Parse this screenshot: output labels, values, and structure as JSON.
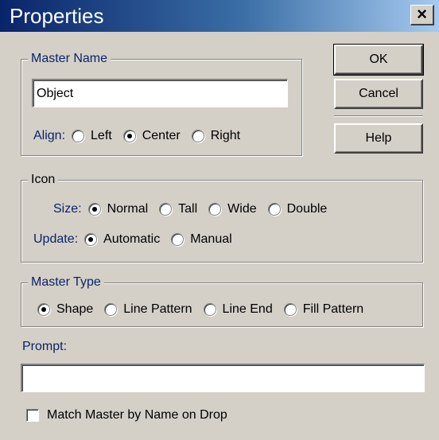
{
  "window": {
    "title": "Properties",
    "close_label": "×"
  },
  "buttons": {
    "ok": "OK",
    "cancel": "Cancel",
    "help": "Help"
  },
  "master_name": {
    "legend": "Master Name",
    "value": "Object",
    "align_label": "Align:",
    "align_options": [
      "Left",
      "Center",
      "Right"
    ],
    "align_selected": "Center"
  },
  "icon": {
    "legend": "Icon",
    "size_label": "Size:",
    "size_options": [
      "Normal",
      "Tall",
      "Wide",
      "Double"
    ],
    "size_selected": "Normal",
    "update_label": "Update:",
    "update_options": [
      "Automatic",
      "Manual"
    ],
    "update_selected": "Automatic"
  },
  "master_type": {
    "legend": "Master Type",
    "options": [
      "Shape",
      "Line Pattern",
      "Line End",
      "Fill Pattern"
    ],
    "selected": "Shape"
  },
  "prompt": {
    "label": "Prompt:",
    "value": ""
  },
  "match_master": {
    "label": "Match Master by Name on Drop",
    "checked": false
  },
  "colors": {
    "title_bar_start": "#0a246a",
    "title_bar_end": "#a6caf0",
    "dialog_bg": "#d4d0c8",
    "label_accent": "#0a246a"
  }
}
